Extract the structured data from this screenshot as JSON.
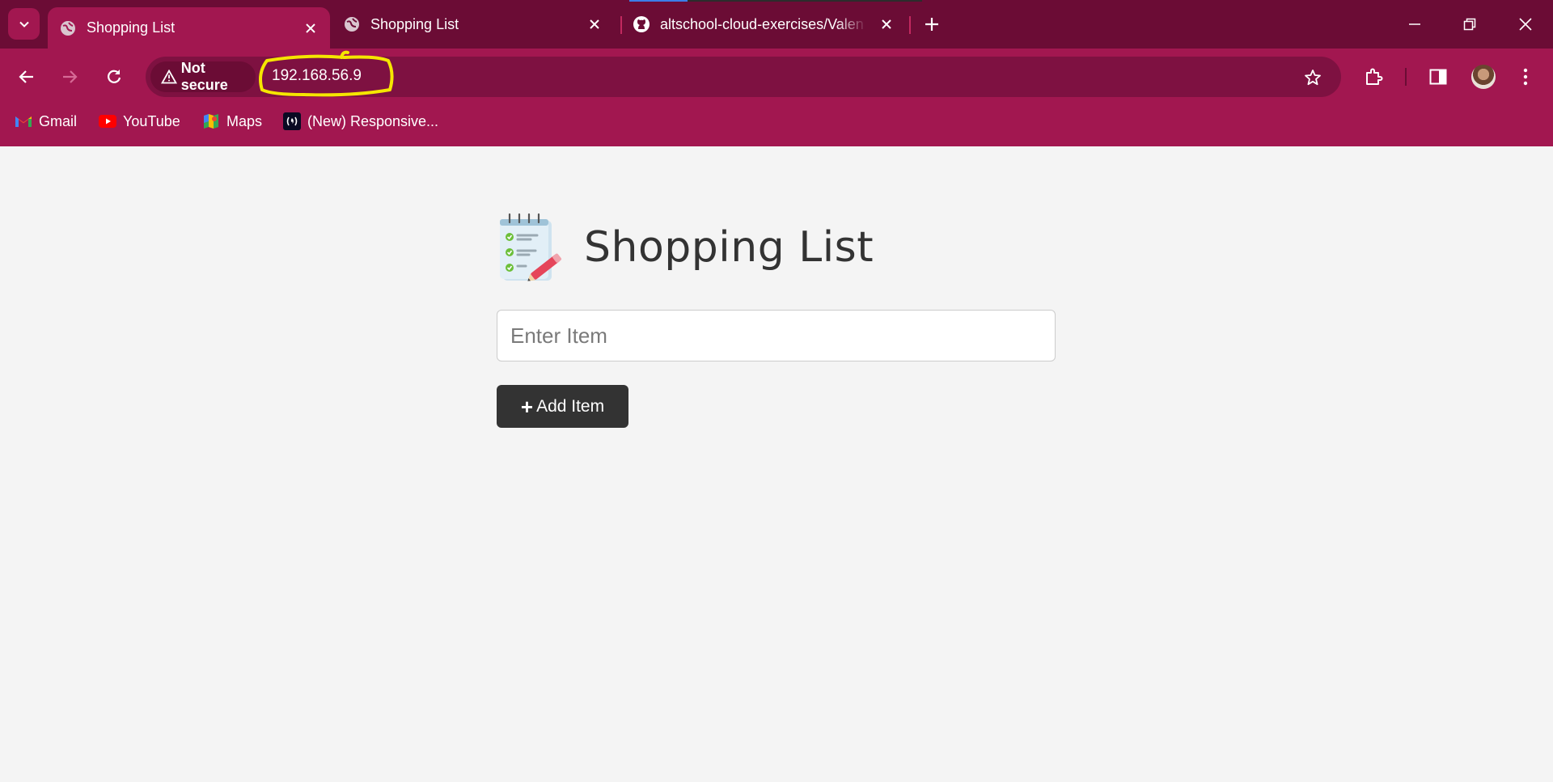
{
  "browser": {
    "tabs": [
      {
        "title": "Shopping List",
        "favicon": "globe-icon",
        "active": true
      },
      {
        "title": "Shopping List",
        "favicon": "globe-icon",
        "active": false
      },
      {
        "title": "altschool-cloud-exercises/Valen",
        "favicon": "github-icon",
        "active": false
      }
    ],
    "security_label": "Not secure",
    "url": "192.168.56.9",
    "bookmarks": [
      {
        "label": "Gmail",
        "icon": "gmail-icon"
      },
      {
        "label": "YouTube",
        "icon": "youtube-icon"
      },
      {
        "label": "Maps",
        "icon": "maps-icon"
      },
      {
        "label": "(New) Responsive...",
        "icon": "freecodecamp-icon"
      }
    ],
    "colors": {
      "frame": "#6b0c35",
      "toolbar": "#a21750",
      "omnibox": "#7e1141",
      "annotation": "#f5e600"
    }
  },
  "app": {
    "title": "Shopping List",
    "icon": "notepad-checklist-icon",
    "input_placeholder": "Enter Item",
    "input_value": "",
    "add_button_label": "Add Item"
  }
}
